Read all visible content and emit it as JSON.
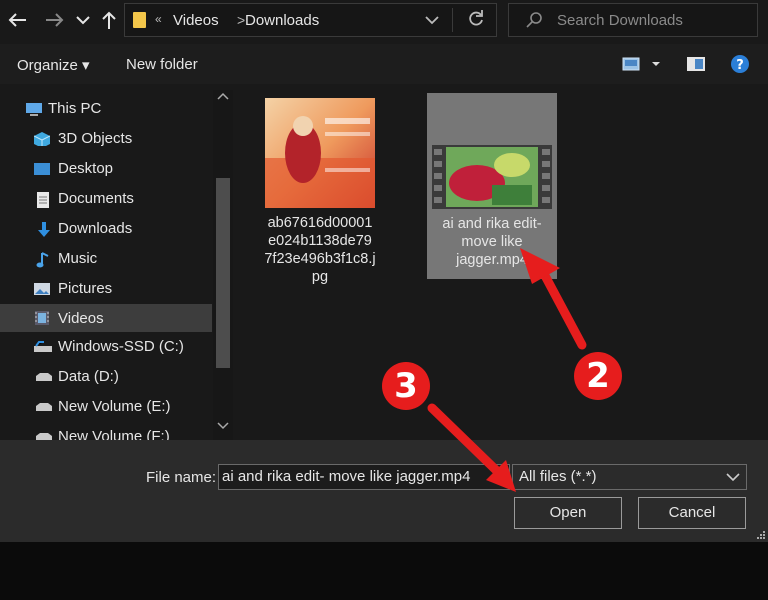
{
  "window": {
    "address": {
      "more": "«",
      "crumbs": [
        "Videos",
        "Downloads"
      ],
      "separator": ">"
    },
    "search": {
      "placeholder": "Search Downloads"
    }
  },
  "commandbar": {
    "organize": "Organize ▾",
    "new_folder": "New folder"
  },
  "sidebar": {
    "items": [
      {
        "label": "This PC",
        "icon": "this-pc-icon"
      },
      {
        "label": "3D Objects",
        "icon": "3d-objects-icon"
      },
      {
        "label": "Desktop",
        "icon": "desktop-icon"
      },
      {
        "label": "Documents",
        "icon": "documents-icon"
      },
      {
        "label": "Downloads",
        "icon": "downloads-icon"
      },
      {
        "label": "Music",
        "icon": "music-icon"
      },
      {
        "label": "Pictures",
        "icon": "pictures-icon"
      },
      {
        "label": "Videos",
        "icon": "videos-icon",
        "selected": true
      },
      {
        "label": "Windows-SSD (C:)",
        "icon": "drive-icon"
      },
      {
        "label": "Data (D:)",
        "icon": "drive-icon"
      },
      {
        "label": "New Volume (E:)",
        "icon": "drive-icon"
      },
      {
        "label": "New Volume (F:)",
        "icon": "drive-icon"
      }
    ]
  },
  "files": [
    {
      "name_lines": [
        "ab67616d00001",
        "e024b1138de79",
        "7f23e496b3f1c8.j",
        "pg"
      ],
      "type": "image"
    },
    {
      "name_lines": [
        "ai and rika edit-",
        "move like",
        "jagger.mp4"
      ],
      "type": "video",
      "selected": true
    }
  ],
  "bottom": {
    "file_name_label": "File name:",
    "file_name_value": "ai and rika edit- move like jagger.mp4",
    "file_type": "All files (*.*)",
    "open_label": "Open",
    "cancel_label": "Cancel"
  },
  "annotations": {
    "badge_2": "2",
    "badge_3": "3",
    "accent_color": "#e61d1d"
  }
}
